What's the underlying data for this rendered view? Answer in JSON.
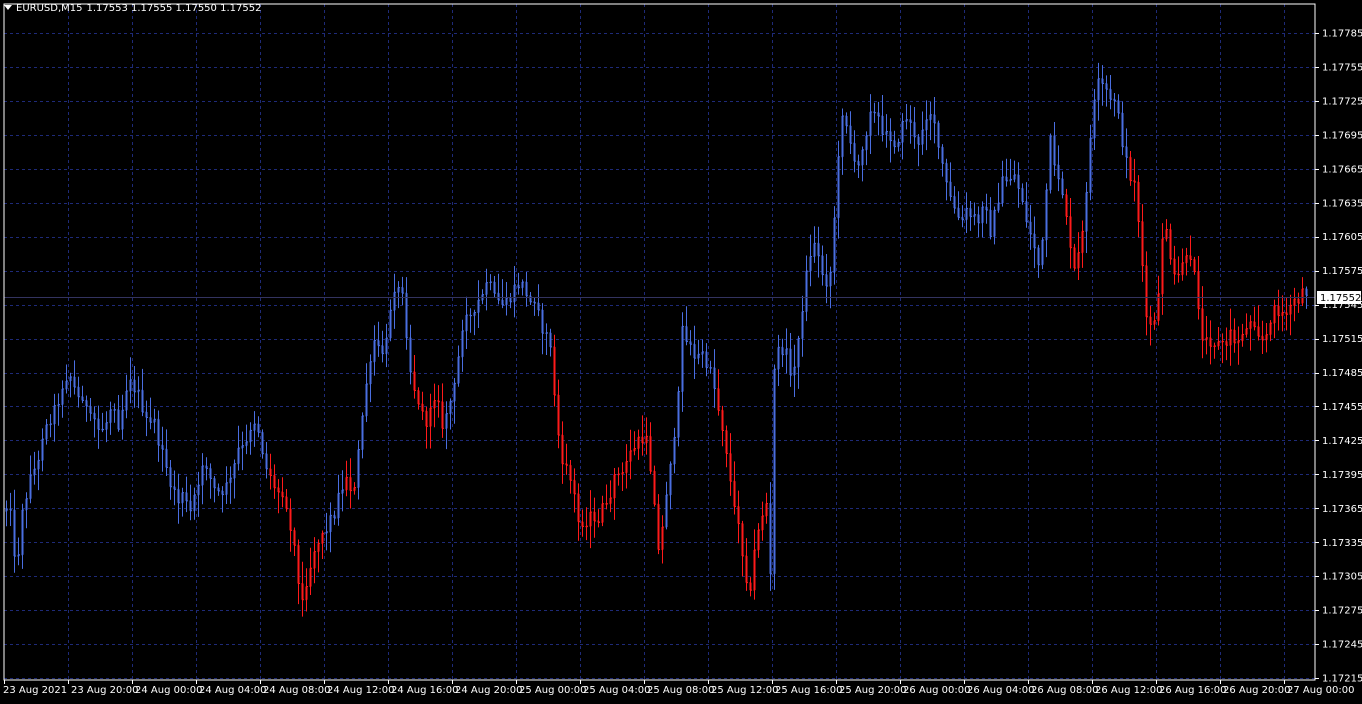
{
  "header": {
    "symbol": "EURUSD,M15",
    "ohlc": "1.17553 1.17555 1.17550 1.17552"
  },
  "colors": {
    "background": "#000000",
    "grid": "#1e2a78",
    "frame": "#ffffff",
    "bull": "#4a6ee0",
    "bear": "#ff1a1a",
    "price_line": "#33335f",
    "price_tag_bg": "#ffffff",
    "price_tag_text": "#000000"
  },
  "chart_data": {
    "type": "bar",
    "style": "OHLC bars (MetaTrader)",
    "symbol": "EURUSD",
    "timeframe": "M15",
    "current_price": 1.17552,
    "y_ticks": [
      "1.17785",
      "1.17755",
      "1.17725",
      "1.17695",
      "1.17665",
      "1.17635",
      "1.17605",
      "1.17575",
      "1.17545",
      "1.17515",
      "1.17485",
      "1.17455",
      "1.17425",
      "1.17395",
      "1.17365",
      "1.17335",
      "1.17305",
      "1.17275",
      "1.17245",
      "1.17215"
    ],
    "x_ticks": [
      "23 Aug 2021",
      "23 Aug 20:00",
      "24 Aug 00:00",
      "24 Aug 04:00",
      "24 Aug 08:00",
      "24 Aug 12:00",
      "24 Aug 16:00",
      "24 Aug 20:00",
      "25 Aug 00:00",
      "25 Aug 04:00",
      "25 Aug 08:00",
      "25 Aug 12:00",
      "25 Aug 16:00",
      "25 Aug 20:00",
      "26 Aug 00:00",
      "26 Aug 04:00",
      "26 Aug 08:00",
      "26 Aug 12:00",
      "26 Aug 16:00",
      "26 Aug 20:00",
      "27 Aug 00:00"
    ],
    "ylim": [
      1.17205,
      1.17795
    ],
    "grid": true,
    "bar_count": 326,
    "close_path": [
      [
        0,
        1.1727
      ],
      [
        4,
        1.1734
      ],
      [
        8,
        1.17385
      ],
      [
        12,
        1.1733
      ],
      [
        18,
        1.1732
      ],
      [
        22,
        1.1736
      ],
      [
        28,
        1.17385
      ],
      [
        34,
        1.174
      ],
      [
        40,
        1.17415
      ],
      [
        46,
        1.17435
      ],
      [
        52,
        1.17445
      ],
      [
        58,
        1.1746
      ],
      [
        64,
        1.1747
      ],
      [
        70,
        1.1748
      ],
      [
        76,
        1.1747
      ],
      [
        82,
        1.17455
      ],
      [
        88,
        1.1746
      ],
      [
        94,
        1.17445
      ],
      [
        100,
        1.1743
      ],
      [
        106,
        1.1744
      ],
      [
        112,
        1.17455
      ],
      [
        118,
        1.1743
      ],
      [
        124,
        1.1746
      ],
      [
        130,
        1.17475
      ],
      [
        136,
        1.1747
      ],
      [
        142,
        1.17455
      ],
      [
        148,
        1.17445
      ],
      [
        154,
        1.1744
      ],
      [
        160,
        1.1742
      ],
      [
        166,
        1.174
      ],
      [
        172,
        1.17385
      ],
      [
        178,
        1.1737
      ],
      [
        184,
        1.1738
      ],
      [
        190,
        1.17365
      ],
      [
        196,
        1.17385
      ],
      [
        202,
        1.174
      ],
      [
        208,
        1.17395
      ],
      [
        214,
        1.17385
      ],
      [
        220,
        1.1738
      ],
      [
        226,
        1.17385
      ],
      [
        232,
        1.174
      ],
      [
        238,
        1.1742
      ],
      [
        244,
        1.17425
      ],
      [
        250,
        1.1743
      ],
      [
        256,
        1.1744
      ],
      [
        262,
        1.1741
      ],
      [
        268,
        1.17395
      ],
      [
        274,
        1.17385
      ],
      [
        280,
        1.17375
      ],
      [
        286,
        1.1736
      ],
      [
        292,
        1.1734
      ],
      [
        298,
        1.173
      ],
      [
        304,
        1.1728
      ],
      [
        310,
        1.1731
      ],
      [
        316,
        1.1733
      ],
      [
        322,
        1.1734
      ],
      [
        328,
        1.1735
      ],
      [
        334,
        1.1736
      ],
      [
        340,
        1.1738
      ],
      [
        346,
        1.1739
      ],
      [
        352,
        1.1737
      ],
      [
        358,
        1.1742
      ],
      [
        364,
        1.1746
      ],
      [
        370,
        1.175
      ],
      [
        376,
        1.1752
      ],
      [
        382,
        1.175
      ],
      [
        388,
        1.1753
      ],
      [
        394,
        1.1755
      ],
      [
        400,
        1.1757
      ],
      [
        406,
        1.1751
      ],
      [
        412,
        1.1747
      ],
      [
        418,
        1.1746
      ],
      [
        424,
        1.1744
      ],
      [
        430,
        1.1745
      ],
      [
        436,
        1.1746
      ],
      [
        442,
        1.1744
      ],
      [
        448,
        1.1745
      ],
      [
        454,
        1.1748
      ],
      [
        460,
        1.1751
      ],
      [
        466,
        1.1753
      ],
      [
        472,
        1.1754
      ],
      [
        478,
        1.1755
      ],
      [
        484,
        1.1756
      ],
      [
        490,
        1.1757
      ],
      [
        496,
        1.17555
      ],
      [
        502,
        1.17545
      ],
      [
        508,
        1.1755
      ],
      [
        514,
        1.1756
      ],
      [
        520,
        1.17565
      ],
      [
        526,
        1.17555
      ],
      [
        532,
        1.17545
      ],
      [
        538,
        1.17535
      ],
      [
        544,
        1.1752
      ],
      [
        550,
        1.1751
      ],
      [
        556,
        1.1744
      ],
      [
        562,
        1.1741
      ],
      [
        568,
        1.17395
      ],
      [
        574,
        1.1738
      ],
      [
        580,
        1.1734
      ],
      [
        586,
        1.1735
      ],
      [
        592,
        1.1736
      ],
      [
        598,
        1.17355
      ],
      [
        604,
        1.1737
      ],
      [
        610,
        1.1738
      ],
      [
        616,
        1.17395
      ],
      [
        622,
        1.174
      ],
      [
        628,
        1.1741
      ],
      [
        634,
        1.1742
      ],
      [
        640,
        1.1743
      ],
      [
        646,
        1.17425
      ],
      [
        652,
        1.1738
      ],
      [
        658,
        1.1733
      ],
      [
        664,
        1.1736
      ],
      [
        670,
        1.174
      ],
      [
        676,
        1.1745
      ],
      [
        682,
        1.1752
      ],
      [
        688,
        1.1751
      ],
      [
        694,
        1.175
      ],
      [
        700,
        1.17505
      ],
      [
        706,
        1.17495
      ],
      [
        712,
        1.1748
      ],
      [
        718,
        1.1745
      ],
      [
        724,
        1.1742
      ],
      [
        730,
        1.1739
      ],
      [
        736,
        1.1736
      ],
      [
        742,
        1.1732
      ],
      [
        748,
        1.1728
      ],
      [
        754,
        1.1733
      ],
      [
        760,
        1.1735
      ],
      [
        766,
        1.1737
      ],
      [
        770,
        1.1731
      ],
      [
        774,
        1.1749
      ],
      [
        780,
        1.1751
      ],
      [
        786,
        1.175
      ],
      [
        792,
        1.1748
      ],
      [
        798,
        1.1751
      ],
      [
        804,
        1.1756
      ],
      [
        810,
        1.1759
      ],
      [
        816,
        1.176
      ],
      [
        822,
        1.1757
      ],
      [
        828,
        1.1755
      ],
      [
        834,
        1.1762
      ],
      [
        840,
        1.1771
      ],
      [
        846,
        1.177
      ],
      [
        852,
        1.1768
      ],
      [
        858,
        1.1767
      ],
      [
        864,
        1.1768
      ],
      [
        870,
        1.1771
      ],
      [
        876,
        1.1772
      ],
      [
        882,
        1.177
      ],
      [
        888,
        1.1769
      ],
      [
        894,
        1.1768
      ],
      [
        900,
        1.177
      ],
      [
        906,
        1.1771
      ],
      [
        912,
        1.177
      ],
      [
        918,
        1.1769
      ],
      [
        924,
        1.177
      ],
      [
        930,
        1.1771
      ],
      [
        936,
        1.177
      ],
      [
        942,
        1.1767
      ],
      [
        948,
        1.1765
      ],
      [
        954,
        1.1763
      ],
      [
        960,
        1.1762
      ],
      [
        966,
        1.1763
      ],
      [
        972,
        1.17625
      ],
      [
        978,
        1.1762
      ],
      [
        984,
        1.1763
      ],
      [
        990,
        1.1761
      ],
      [
        996,
        1.1763
      ],
      [
        1002,
        1.1766
      ],
      [
        1008,
        1.1765
      ],
      [
        1014,
        1.1766
      ],
      [
        1020,
        1.1764
      ],
      [
        1026,
        1.1762
      ],
      [
        1032,
        1.176
      ],
      [
        1038,
        1.1758
      ],
      [
        1044,
        1.1762
      ],
      [
        1050,
        1.177
      ],
      [
        1056,
        1.1766
      ],
      [
        1062,
        1.1764
      ],
      [
        1068,
        1.1761
      ],
      [
        1074,
        1.1758
      ],
      [
        1080,
        1.176
      ],
      [
        1086,
        1.1764
      ],
      [
        1092,
        1.1772
      ],
      [
        1098,
        1.1775
      ],
      [
        1104,
        1.1774
      ],
      [
        1110,
        1.1773
      ],
      [
        1116,
        1.1772
      ],
      [
        1122,
        1.1769
      ],
      [
        1128,
        1.1766
      ],
      [
        1134,
        1.1765
      ],
      [
        1140,
        1.176
      ],
      [
        1146,
        1.1754
      ],
      [
        1152,
        1.1752
      ],
      [
        1158,
        1.1756
      ],
      [
        1164,
        1.1762
      ],
      [
        1170,
        1.1759
      ],
      [
        1176,
        1.1757
      ],
      [
        1182,
        1.1758
      ],
      [
        1188,
        1.176
      ],
      [
        1194,
        1.1757
      ],
      [
        1200,
        1.1752
      ],
      [
        1206,
        1.1751
      ],
      [
        1212,
        1.175
      ],
      [
        1218,
        1.17515
      ],
      [
        1224,
        1.1751
      ],
      [
        1230,
        1.1752
      ],
      [
        1236,
        1.1751
      ],
      [
        1242,
        1.17515
      ],
      [
        1248,
        1.1753
      ],
      [
        1254,
        1.1752
      ],
      [
        1260,
        1.1751
      ],
      [
        1266,
        1.1752
      ],
      [
        1272,
        1.1754
      ],
      [
        1278,
        1.17535
      ],
      [
        1284,
        1.1754
      ],
      [
        1290,
        1.17545
      ],
      [
        1296,
        1.1755
      ],
      [
        1302,
        1.17555
      ],
      [
        1306,
        1.17552
      ]
    ],
    "bear_segments": [
      [
        270,
        322
      ],
      [
        345,
        356
      ],
      [
        414,
        442
      ],
      [
        552,
        665
      ],
      [
        718,
        768
      ],
      [
        1064,
        1084
      ],
      [
        1127,
        1305
      ]
    ]
  }
}
